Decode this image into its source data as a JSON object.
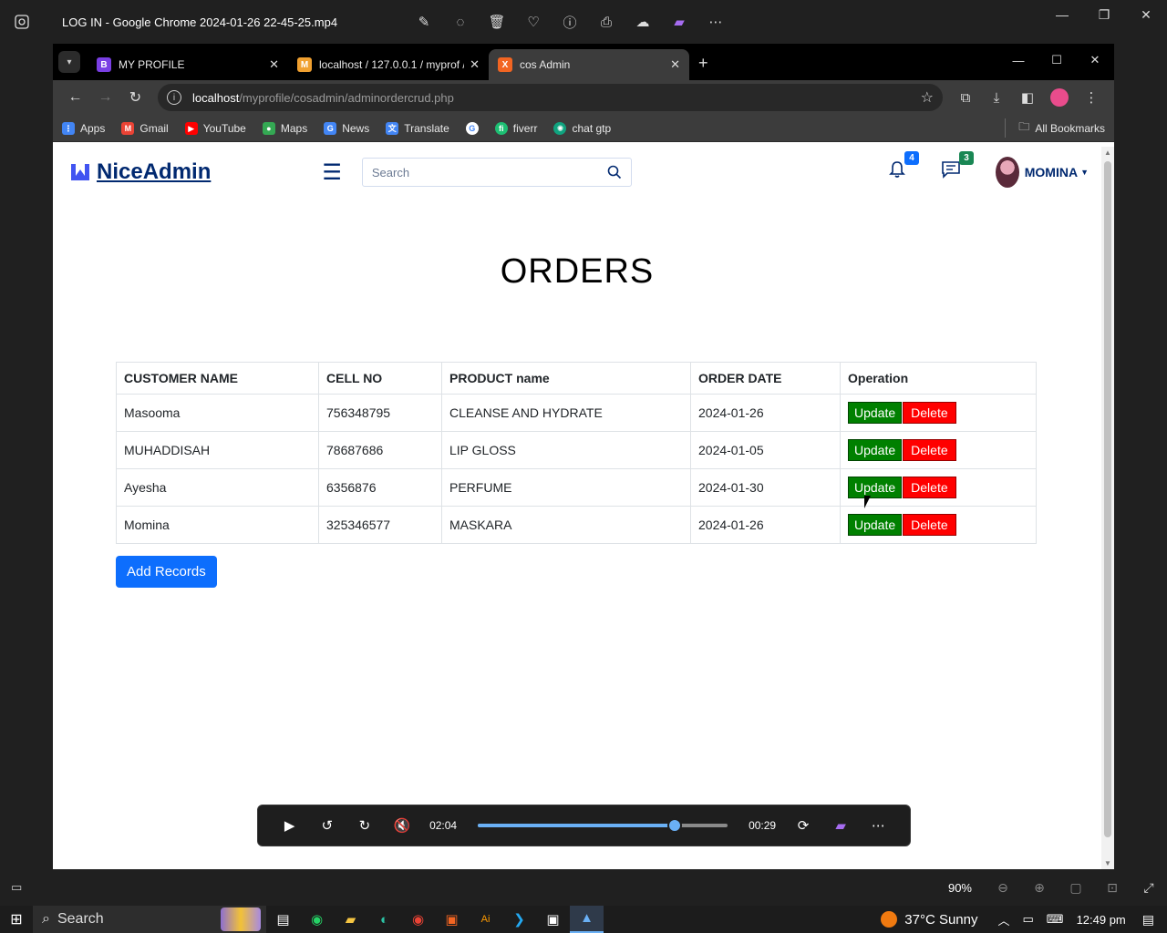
{
  "app": {
    "title": "LOG IN - Google Chrome 2024-01-26 22-45-25.mp4",
    "tool_icons": [
      "edit-icon",
      "ai-icon",
      "trash-icon",
      "heart-icon",
      "info-icon",
      "print-icon",
      "onedrive-icon",
      "clipchamp-icon",
      "more-icon"
    ]
  },
  "browser": {
    "tabs": [
      {
        "label": "MY PROFILE",
        "favicon": "B",
        "favicon_color": "#7a3fe4",
        "active": false
      },
      {
        "label": "localhost / 127.0.0.1 / myprof /",
        "favicon": "M",
        "favicon_color": "#f0a030",
        "active": false
      },
      {
        "label": "cos Admin",
        "favicon": "X",
        "favicon_color": "#f26522",
        "active": true
      }
    ],
    "url_host": "localhost",
    "url_path": "/myprofile/cosadmin/adminordercrud.php",
    "bookmarks": [
      {
        "label": "Apps",
        "color": "#4285f4"
      },
      {
        "label": "Gmail",
        "color": "#ea4335"
      },
      {
        "label": "YouTube",
        "color": "#ff0000"
      },
      {
        "label": "Maps",
        "color": "#34a853"
      },
      {
        "label": "News",
        "color": "#4285f4"
      },
      {
        "label": "Translate",
        "color": "#4285f4"
      },
      {
        "label": "",
        "color": "#ffffff"
      },
      {
        "label": "fiverr",
        "color": "#1dbf73"
      },
      {
        "label": "chat gtp",
        "color": "#10a37f"
      }
    ],
    "all_bookmarks": "All Bookmarks"
  },
  "site": {
    "logo": "NiceAdmin",
    "search_placeholder": "Search",
    "notifications_count": "4",
    "messages_count": "3",
    "user_name": "MOMINA",
    "page_title": "ORDERS",
    "table": {
      "headers": [
        "CUSTOMER NAME",
        "CELL NO",
        "PRODUCT name",
        "ORDER DATE",
        "Operation"
      ],
      "rows": [
        {
          "name": "Masooma",
          "cell": "756348795",
          "product": "CLEANSE AND HYDRATE",
          "date": "2024-01-26"
        },
        {
          "name": "MUHADDISAH",
          "cell": "78687686",
          "product": "LIP GLOSS",
          "date": "2024-01-05"
        },
        {
          "name": "Ayesha",
          "cell": "6356876",
          "product": "PERFUME",
          "date": "2024-01-30"
        },
        {
          "name": "Momina",
          "cell": "325346577",
          "product": "MASKARA",
          "date": "2024-01-26"
        }
      ],
      "update_label": "Update",
      "delete_label": "Delete"
    },
    "add_button": "Add Records"
  },
  "player": {
    "elapsed": "02:04",
    "remaining": "00:29",
    "progress": 0.79
  },
  "statusbar": {
    "zoom": "90%"
  },
  "taskbar": {
    "search": "Search",
    "weather": "37°C  Sunny",
    "time": "12:49 pm"
  }
}
